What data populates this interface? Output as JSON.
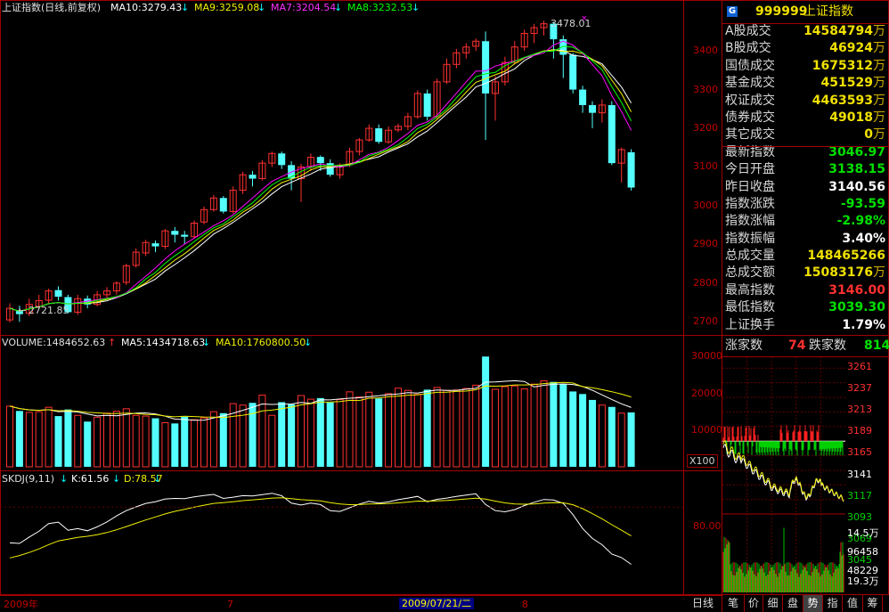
{
  "header": {
    "index_title": "上证指数(日线,前复权)",
    "ma10": "MA10:3279.43",
    "ma9": "MA9:3259.08",
    "ma7": "MA7:3204.54",
    "ma8": "MA8:3232.53"
  },
  "price_panel": {
    "high_label": "3478.01",
    "low_label": "2721.85",
    "y_ticks": [
      "3400",
      "3300",
      "3200",
      "3100",
      "3000",
      "2900",
      "2800",
      "2700"
    ]
  },
  "volume_panel": {
    "volume": "VOLUME:1484652.63",
    "ma5": "MA5:1434718.63",
    "ma10": "MA10:1760800.50",
    "y_ticks": [
      "30000",
      "20000",
      "10000"
    ],
    "unit_box": "X100"
  },
  "kdj_panel": {
    "name": "SKDJ(9,11)",
    "k": "K:61.56",
    "d": "D:78.57",
    "y_tick": "80.00"
  },
  "x_axis": {
    "year": "2009年",
    "month7": "7",
    "cursor_date": "2009/07/21/二",
    "month8": "8"
  },
  "side_header": {
    "icon": "G",
    "code": "999999",
    "name": "上证指数"
  },
  "stats": [
    {
      "label": "A股成交",
      "value": "14584794",
      "unit": "万",
      "color": "#f0e000"
    },
    {
      "label": "B股成交",
      "value": "46924",
      "unit": "万",
      "color": "#f0e000"
    },
    {
      "label": "国债成交",
      "value": "1675312",
      "unit": "万",
      "color": "#f0e000"
    },
    {
      "label": "基金成交",
      "value": "451529",
      "unit": "万",
      "color": "#f0e000"
    },
    {
      "label": "权证成交",
      "value": "4463593",
      "unit": "万",
      "color": "#f0e000"
    },
    {
      "label": "债券成交",
      "value": "49018",
      "unit": "万",
      "color": "#f0e000"
    },
    {
      "label": "其它成交",
      "value": "0",
      "unit": "万",
      "color": "#f0e000"
    },
    {
      "label": "最新指数",
      "value": "3046.97",
      "unit": "",
      "color": "#00e000"
    },
    {
      "label": "今日开盘",
      "value": "3138.15",
      "unit": "",
      "color": "#00e000"
    },
    {
      "label": "昨日收盘",
      "value": "3140.56",
      "unit": "",
      "color": "#ffffff"
    },
    {
      "label": "指数涨跌",
      "value": "-93.59",
      "unit": "",
      "color": "#00e000"
    },
    {
      "label": "指数涨幅",
      "value": "-2.98%",
      "unit": "",
      "color": "#00e000"
    },
    {
      "label": "指数振幅",
      "value": "3.40%",
      "unit": "",
      "color": "#ffffff"
    },
    {
      "label": "总成交量",
      "value": "148465266",
      "unit": "",
      "color": "#f0e000"
    },
    {
      "label": "总成交额",
      "value": "15083176",
      "unit": "万",
      "color": "#f0e000"
    },
    {
      "label": "最高指数",
      "value": "3146.00",
      "unit": "",
      "color": "#ff3030"
    },
    {
      "label": "最低指数",
      "value": "3039.30",
      "unit": "",
      "color": "#00e000"
    },
    {
      "label": "上证换手",
      "value": "1.79%",
      "unit": "",
      "color": "#ffffff"
    }
  ],
  "breadth": {
    "up_label": "涨家数",
    "up_value": "74",
    "down_label": "跌家数",
    "down_value": "814"
  },
  "mini_chart": {
    "y_ticks": [
      "3261",
      "3237",
      "3213",
      "3189",
      "3165",
      "3141",
      "3117",
      "3093",
      "3069",
      "3045",
      "19.3万"
    ],
    "vol_ticks": [
      "14.5万",
      "96458",
      "48229"
    ]
  },
  "bottom_tabs": [
    "日线",
    "笔",
    "价",
    "细",
    "盘",
    "势",
    "指",
    "值",
    "筹"
  ],
  "chart_data": {
    "type": "candlestick",
    "candles": [
      [
        2705,
        2735,
        2698,
        2748
      ],
      [
        2728,
        2720,
        2700,
        2742
      ],
      [
        2722,
        2745,
        2715,
        2760
      ],
      [
        2740,
        2755,
        2732,
        2770
      ],
      [
        2756,
        2780,
        2748,
        2786
      ],
      [
        2782,
        2765,
        2755,
        2792
      ],
      [
        2764,
        2725,
        2721.85,
        2770
      ],
      [
        2725,
        2760,
        2718,
        2770
      ],
      [
        2760,
        2745,
        2735,
        2768
      ],
      [
        2745,
        2770,
        2740,
        2780
      ],
      [
        2770,
        2780,
        2760,
        2790
      ],
      [
        2780,
        2800,
        2770,
        2805
      ],
      [
        2802,
        2845,
        2795,
        2850
      ],
      [
        2846,
        2880,
        2840,
        2890
      ],
      [
        2878,
        2905,
        2870,
        2912
      ],
      [
        2903,
        2895,
        2880,
        2910
      ],
      [
        2895,
        2935,
        2888,
        2940
      ],
      [
        2935,
        2925,
        2905,
        2945
      ],
      [
        2925,
        2920,
        2900,
        2935
      ],
      [
        2920,
        2955,
        2915,
        2962
      ],
      [
        2958,
        2990,
        2952,
        2998
      ],
      [
        2990,
        3020,
        2985,
        3028
      ],
      [
        3020,
        2985,
        2980,
        3025
      ],
      [
        2985,
        3040,
        2980,
        3050
      ],
      [
        3040,
        3080,
        3030,
        3088
      ],
      [
        3080,
        3070,
        3050,
        3090
      ],
      [
        3070,
        3110,
        3065,
        3118
      ],
      [
        3110,
        3135,
        3100,
        3140
      ],
      [
        3135,
        3105,
        3095,
        3140
      ],
      [
        3105,
        3070,
        3040,
        3115
      ],
      [
        3070,
        3100,
        3010,
        3108
      ],
      [
        3100,
        3125,
        3090,
        3135
      ],
      [
        3126,
        3110,
        3090,
        3130
      ],
      [
        3110,
        3080,
        3075,
        3120
      ],
      [
        3080,
        3105,
        3070,
        3110
      ],
      [
        3106,
        3140,
        3100,
        3150
      ],
      [
        3140,
        3170,
        3130,
        3175
      ],
      [
        3170,
        3200,
        3165,
        3210
      ],
      [
        3200,
        3165,
        3160,
        3210
      ],
      [
        3165,
        3195,
        3160,
        3205
      ],
      [
        3196,
        3205,
        3190,
        3212
      ],
      [
        3205,
        3230,
        3195,
        3240
      ],
      [
        3230,
        3290,
        3225,
        3298
      ],
      [
        3290,
        3230,
        3220,
        3300
      ],
      [
        3230,
        3320,
        3225,
        3328
      ],
      [
        3320,
        3365,
        3315,
        3380
      ],
      [
        3365,
        3395,
        3355,
        3405
      ],
      [
        3395,
        3410,
        3380,
        3420
      ],
      [
        3412,
        3425,
        3400,
        3432
      ],
      [
        3425,
        3290,
        3170,
        3450
      ],
      [
        3290,
        3320,
        3220,
        3335
      ],
      [
        3320,
        3370,
        3310,
        3385
      ],
      [
        3370,
        3410,
        3365,
        3425
      ],
      [
        3410,
        3445,
        3400,
        3455
      ],
      [
        3445,
        3460,
        3420,
        3470
      ],
      [
        3460,
        3470,
        3440,
        3478.01
      ],
      [
        3470,
        3430,
        3380,
        3475
      ],
      [
        3430,
        3390,
        3330,
        3440
      ],
      [
        3390,
        3300,
        3290,
        3395
      ],
      [
        3300,
        3260,
        3240,
        3310
      ],
      [
        3260,
        3240,
        3200,
        3270
      ],
      [
        3240,
        3260,
        3215,
        3275
      ],
      [
        3260,
        3110,
        3105,
        3270
      ],
      [
        3110,
        3145,
        3060,
        3150
      ],
      [
        3138.15,
        3046.97,
        3039.3,
        3146
      ]
    ],
    "volumes": [
      16500,
      15200,
      14800,
      15000,
      16200,
      13800,
      15600,
      14000,
      12300,
      13500,
      14600,
      15100,
      15800,
      14000,
      13800,
      13200,
      12000,
      11800,
      13600,
      12800,
      13300,
      15000,
      14600,
      17200,
      16800,
      17400,
      19500,
      14000,
      17600,
      17000,
      19400,
      18400,
      18700,
      17500,
      18300,
      20400,
      19000,
      20300,
      18600,
      19900,
      21400,
      20800,
      19700,
      21000,
      21600,
      20800,
      20900,
      21300,
      22200,
      30000,
      21100,
      21800,
      22000,
      21200,
      22500,
      23400,
      23100,
      22500,
      20500,
      19800,
      18200,
      16800,
      16300,
      14600,
      14800
    ],
    "ma_lines": [
      {
        "name": "MA10",
        "color": "#ffffff",
        "last": 3279.43
      },
      {
        "name": "MA9",
        "color": "#f0f000",
        "last": 3259.08
      },
      {
        "name": "MA7",
        "color": "#ff00ff",
        "last": 3204.54
      },
      {
        "name": "MA8",
        "color": "#00ff00",
        "last": 3232.53
      }
    ],
    "kdj": {
      "k_last": 61.56,
      "d_last": 78.57
    },
    "y_range": [
      2680,
      3490
    ],
    "vol_range": [
      0,
      32000
    ],
    "mini_price_range": [
      3033,
      3273
    ],
    "mini_open": 3141
  }
}
